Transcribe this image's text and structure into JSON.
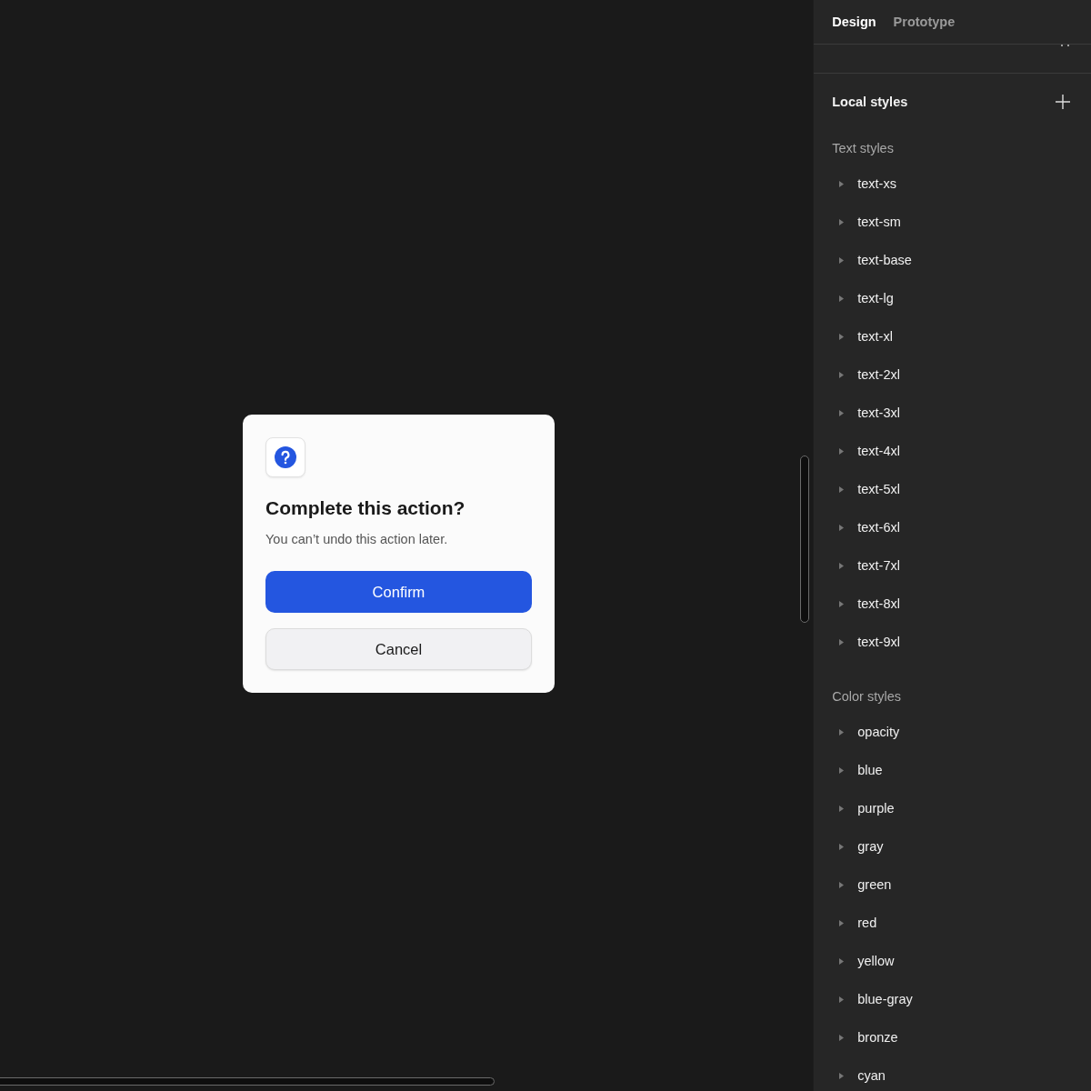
{
  "dialog": {
    "title": "Complete this action?",
    "message": "You can’t undo this action later.",
    "buttons": [
      {
        "label": "Confirm",
        "kind": "primary"
      },
      {
        "label": "Cancel",
        "kind": "secondary"
      }
    ]
  },
  "panel": {
    "tabs": [
      {
        "label": "Design",
        "selected": true
      },
      {
        "label": "Prototype",
        "selected": false
      }
    ],
    "styles_title": "Local styles",
    "groups": [
      {
        "title": "Text styles",
        "items": [
          {
            "label": "text-xs",
            "expanded": false
          },
          {
            "label": "text-sm",
            "expanded": false
          },
          {
            "label": "text-base",
            "expanded": false
          },
          {
            "label": "text-lg",
            "expanded": false
          },
          {
            "label": "text-xl",
            "expanded": false
          },
          {
            "label": "text-2xl",
            "expanded": false
          },
          {
            "label": "text-3xl",
            "expanded": false
          },
          {
            "label": "text-4xl",
            "expanded": false
          },
          {
            "label": "text-5xl",
            "expanded": false
          },
          {
            "label": "text-6xl",
            "expanded": false
          },
          {
            "label": "text-7xl",
            "expanded": false
          },
          {
            "label": "text-8xl",
            "expanded": false
          },
          {
            "label": "text-9xl",
            "expanded": false
          }
        ]
      },
      {
        "title": "Color styles",
        "items": [
          {
            "label": "opacity",
            "expanded": false
          },
          {
            "label": "blue",
            "expanded": false
          },
          {
            "label": "purple",
            "expanded": false
          },
          {
            "label": "gray",
            "expanded": false
          },
          {
            "label": "green",
            "expanded": false
          },
          {
            "label": "red",
            "expanded": false
          },
          {
            "label": "yellow",
            "expanded": false
          },
          {
            "label": "blue-gray",
            "expanded": false
          },
          {
            "label": "bronze",
            "expanded": false
          },
          {
            "label": "cyan",
            "expanded": false
          }
        ]
      }
    ]
  }
}
